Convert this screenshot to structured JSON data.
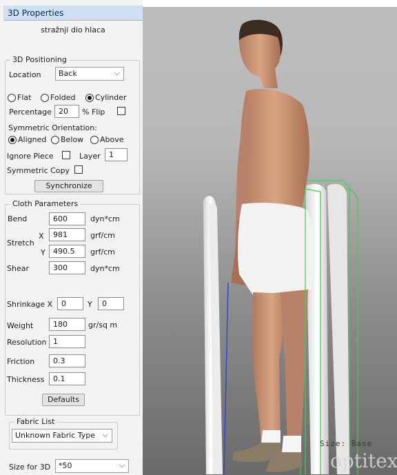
{
  "panel": {
    "title": "3D Properties",
    "piece_name": "stražnji dio hlaca",
    "positioning": {
      "title": "3D Positioning",
      "location_label": "Location",
      "location_value": "Back",
      "shape_options": [
        "Flat",
        "Folded",
        "Cylinder"
      ],
      "shape_selected": "Cylinder",
      "percentage_label": "Percentage",
      "percentage_value": "20",
      "flip_label": "% Flip",
      "flip_checked": false,
      "symmetric_orientation_label": "Symmetric Orientation:",
      "orientation_options": [
        "Aligned",
        "Below",
        "Above"
      ],
      "orientation_selected": "Aligned",
      "ignore_piece_label": "Ignore Piece",
      "ignore_piece_checked": false,
      "layer_label": "Layer",
      "layer_value": "1",
      "symmetric_copy_label": "Symmetric Copy",
      "symmetric_copy_checked": false,
      "synchronize_label": "Synchronize"
    },
    "cloth": {
      "title": "Cloth Parameters",
      "bend_label": "Bend",
      "bend_value": "600",
      "bend_unit": "dyn*cm",
      "stretch_label": "Stretch",
      "stretch_x_label": "X",
      "stretch_x_value": "981",
      "stretch_x_unit": "grf/cm",
      "stretch_y_label": "Y",
      "stretch_y_value": "490.5",
      "stretch_y_unit": "grf/cm",
      "shear_label": "Shear",
      "shear_value": "300",
      "shear_unit": "dyn*cm",
      "shrinkage_x_label": "Shrinkage X",
      "shrinkage_x_value": "0",
      "shrinkage_y_label": "Y",
      "shrinkage_y_value": "0",
      "weight_label": "Weight",
      "weight_value": "180",
      "weight_unit": "gr/sq m",
      "resolution_label": "Resolution",
      "resolution_value": "1",
      "friction_label": "Friction",
      "friction_value": "0.3",
      "thickness_label": "Thickness",
      "thickness_value": "0.1",
      "defaults_label": "Defaults"
    },
    "fabric": {
      "title": "Fabric List",
      "selected": "Unknown Fabric Type"
    },
    "size": {
      "label": "Size for 3D",
      "selected": "*50"
    }
  },
  "viewport": {
    "watermark_size": "Size: Base",
    "watermark_brand": "optitex"
  },
  "colors": {
    "title_bar": "#cfe0f3",
    "panel_bg": "#f3f3f3",
    "cloth_white": "#f2f2f2",
    "bounding_box": "#3fd24a"
  }
}
